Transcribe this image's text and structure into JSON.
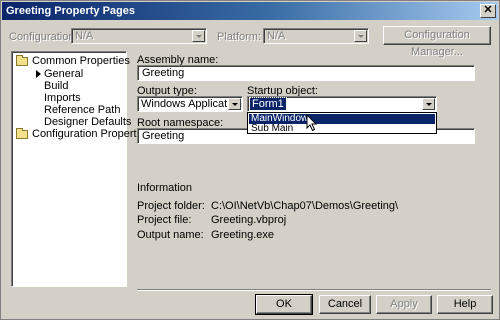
{
  "window": {
    "title": "Greeting Property Pages",
    "close_glyph": "✕"
  },
  "toolbar": {
    "configuration_label": "Configuration:",
    "configuration_value": "N/A",
    "platform_label": "Platform:",
    "platform_value": "N/A",
    "configuration_manager_label": "Configuration Manager..."
  },
  "tree": {
    "items": [
      {
        "label": "Common Properties"
      },
      {
        "label": "General"
      },
      {
        "label": "Build"
      },
      {
        "label": "Imports"
      },
      {
        "label": "Reference Path"
      },
      {
        "label": "Designer Defaults"
      },
      {
        "label": "Configuration Properties"
      }
    ]
  },
  "form": {
    "assembly_name_label": "Assembly name:",
    "assembly_name_value": "Greeting",
    "output_type_label": "Output type:",
    "output_type_value": "Windows Application",
    "startup_object_label": "Startup object:",
    "startup_object_value": "Form1",
    "startup_options": [
      "MainWindow",
      "Sub Main"
    ],
    "root_namespace_label": "Root namespace:",
    "root_namespace_value": "Greeting"
  },
  "information": {
    "heading": "Information",
    "project_folder_label": "Project folder:",
    "project_folder_value": "C:\\OI\\NetVb\\Chap07\\Demos\\Greeting\\",
    "project_file_label": "Project file:",
    "project_file_value": "Greeting.vbproj",
    "output_name_label": "Output name:",
    "output_name_value": "Greeting.exe"
  },
  "buttons": {
    "ok": "OK",
    "cancel": "Cancel",
    "apply": "Apply",
    "help": "Help"
  },
  "colors": {
    "titlebar": "#0a246a",
    "selection": "#0a246a",
    "face": "#d4d0c8"
  }
}
